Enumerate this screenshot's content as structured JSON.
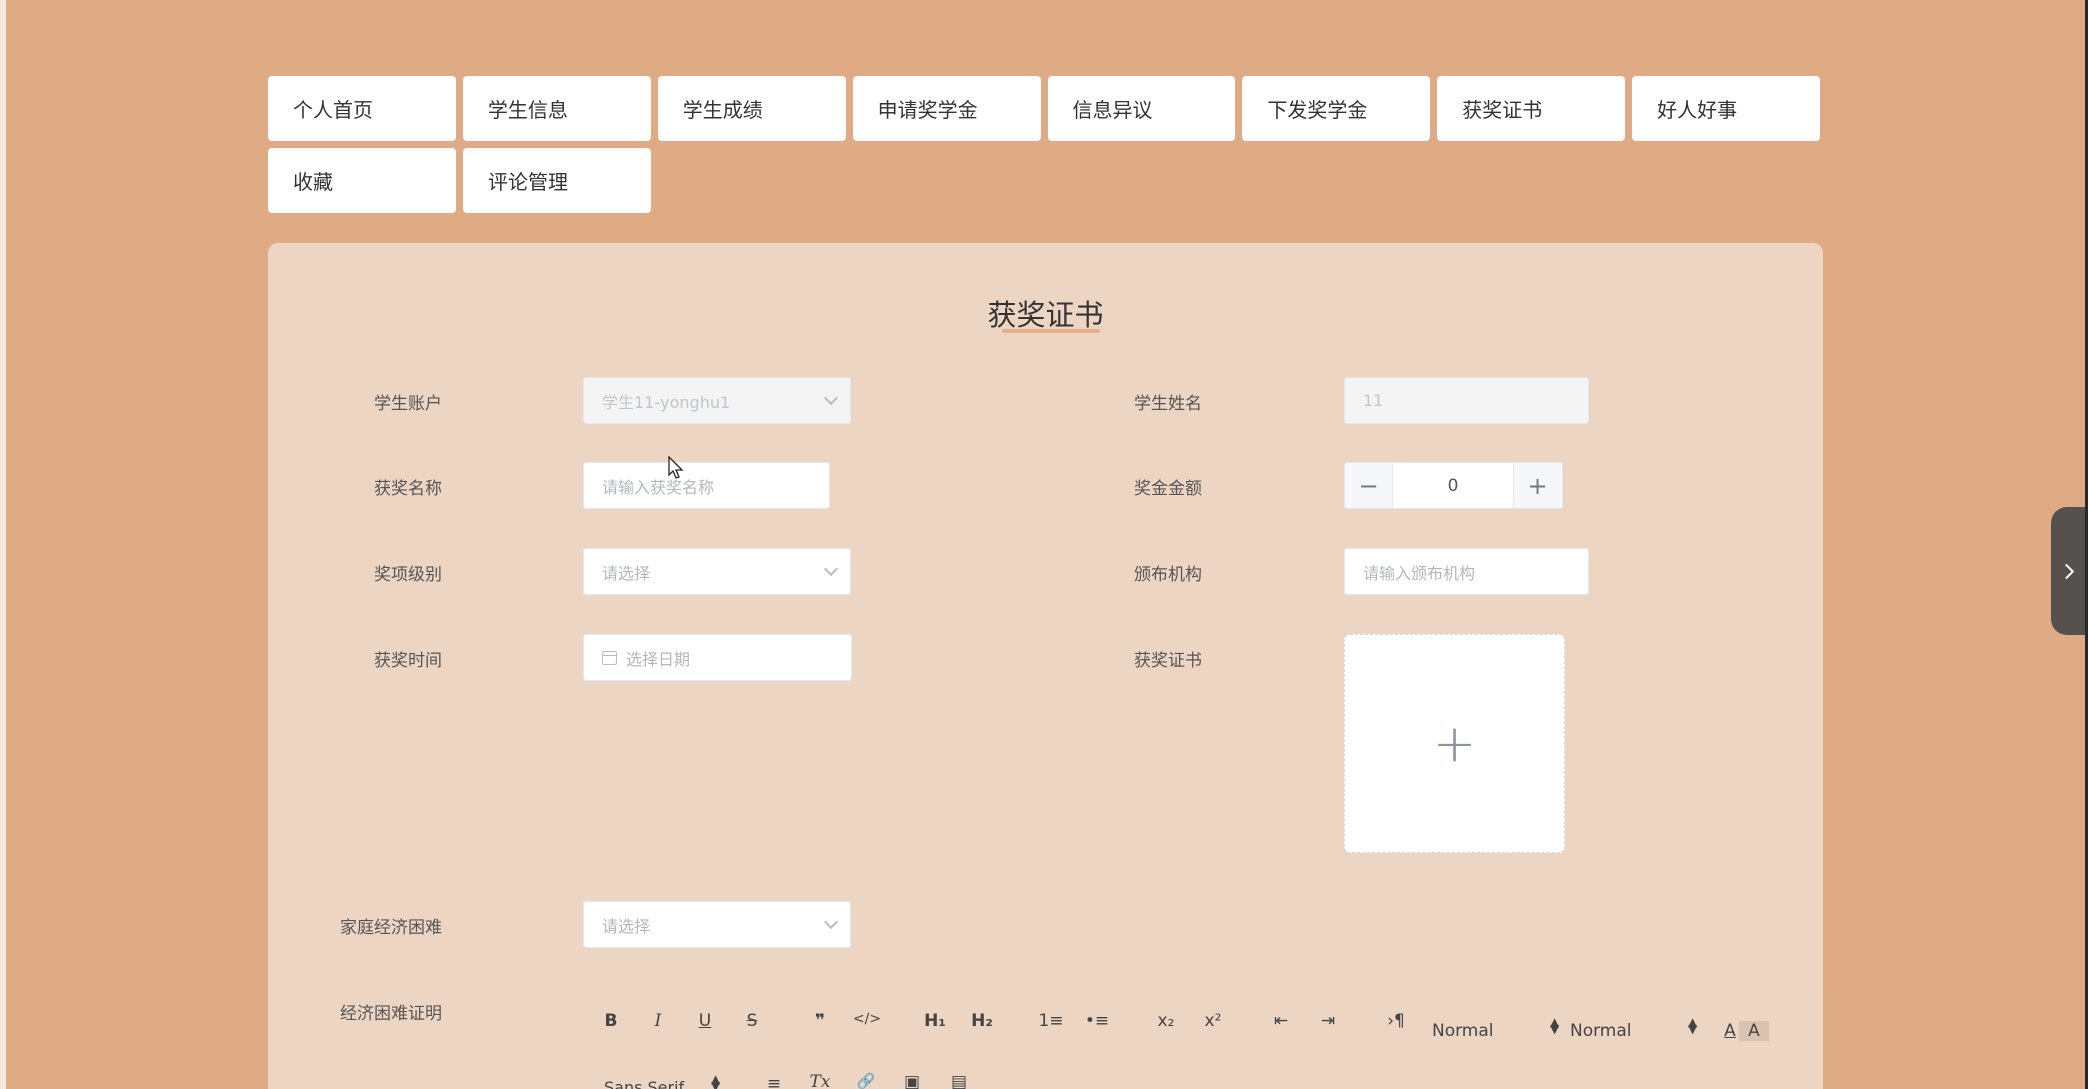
{
  "nav": {
    "row1": [
      "个人首页",
      "学生信息",
      "学生成绩",
      "申请奖学金",
      "信息异议",
      "下发奖学金",
      "获奖证书",
      "好人好事"
    ],
    "row2": [
      "收藏",
      "评论管理"
    ]
  },
  "form": {
    "title": "获奖证书",
    "student_account": {
      "label": "学生账户",
      "value": "学生11-yonghu1"
    },
    "student_name": {
      "label": "学生姓名",
      "value": "11"
    },
    "award_name": {
      "label": "获奖名称",
      "placeholder": "请输入获奖名称"
    },
    "bonus_amount": {
      "label": "奖金金额",
      "value": "0",
      "minus": "−",
      "plus": "+"
    },
    "award_level": {
      "label": "奖项级别",
      "placeholder": "请选择"
    },
    "issuer": {
      "label": "颁布机构",
      "placeholder": "请输入颁布机构"
    },
    "award_time": {
      "label": "获奖时间",
      "placeholder": "选择日期"
    },
    "certificate": {
      "label": "获奖证书",
      "upload_symbol": "+"
    },
    "family_hardship": {
      "label": "家庭经济困难",
      "placeholder": "请选择"
    },
    "hardship_proof": {
      "label": "经济困难证明"
    }
  },
  "editor_toolbar": {
    "bold": "B",
    "italic": "I",
    "underline": "U",
    "strike": "S",
    "quote": "❞",
    "code": "</>",
    "h1": "H₁",
    "h2": "H₂",
    "ordered_list": "1≡",
    "bullet_list": "•≡",
    "subscript": "x₂",
    "superscript": "x²",
    "outdent": "⇤",
    "indent": "⇥",
    "direction": "›¶",
    "size_select": "Normal",
    "header_select": "Normal",
    "font_color": "A",
    "bg_color": "A",
    "font_select": "Sans Serif",
    "align": "≡",
    "clean": "Tx",
    "link": "🔗",
    "image": "▣",
    "video": "▤"
  }
}
